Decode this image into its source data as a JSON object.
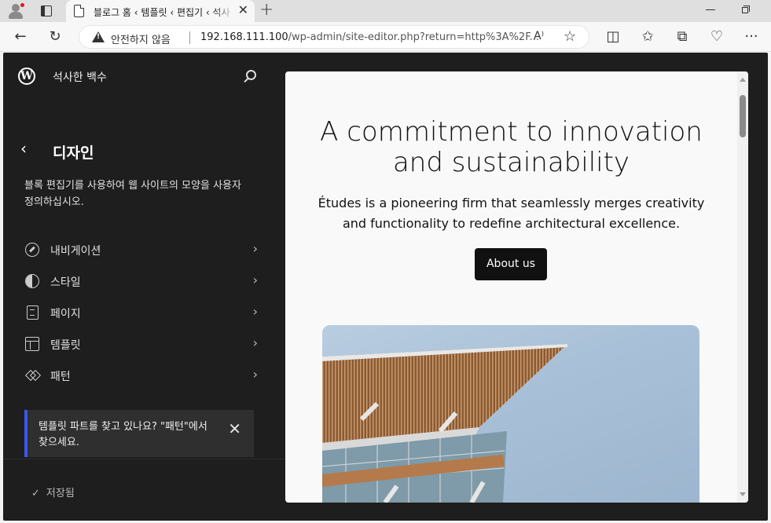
{
  "browser": {
    "tab_title": "블로그 홈 ‹ 템플릿 ‹ 편집기 ‹ 석사",
    "security_label": "안전하지 않음",
    "url_host": "192.168.111.100",
    "url_path": "/wp-admin/site-editor.php?return=http%3A%2F...",
    "icons": [
      "profile-icon",
      "tab-actions-icon",
      "new-tab-icon",
      "back-icon",
      "refresh-icon",
      "warning-icon",
      "read-aloud-icon",
      "favorite-icon",
      "split-screen-icon",
      "favorites-icon",
      "collections-icon",
      "browser-essentials-icon",
      "more-icon"
    ]
  },
  "sidebar": {
    "site_name": "석사한 백수",
    "title": "디자인",
    "description": "블록 편집기를 사용하여 웹 사이트의 모양을 사용자 정의하십시오.",
    "items": [
      {
        "label": "내비게이션",
        "icon": "navigation-icon"
      },
      {
        "label": "스타일",
        "icon": "styles-icon"
      },
      {
        "label": "페이지",
        "icon": "page-icon"
      },
      {
        "label": "템플릿",
        "icon": "template-icon"
      },
      {
        "label": "패턴",
        "icon": "pattern-icon"
      }
    ],
    "notice": "템플릿 파트를 찾고 있나요? \"패턴\"에서 찾으세요.",
    "saved_label": "저장됨",
    "accent": "#3858e9"
  },
  "preview": {
    "heading": "A commitment to innovation and sustainability",
    "subheading": "Études is a pioneering firm that seamlessly merges creativity and functionality to redefine architectural excellence.",
    "button_label": "About us"
  }
}
